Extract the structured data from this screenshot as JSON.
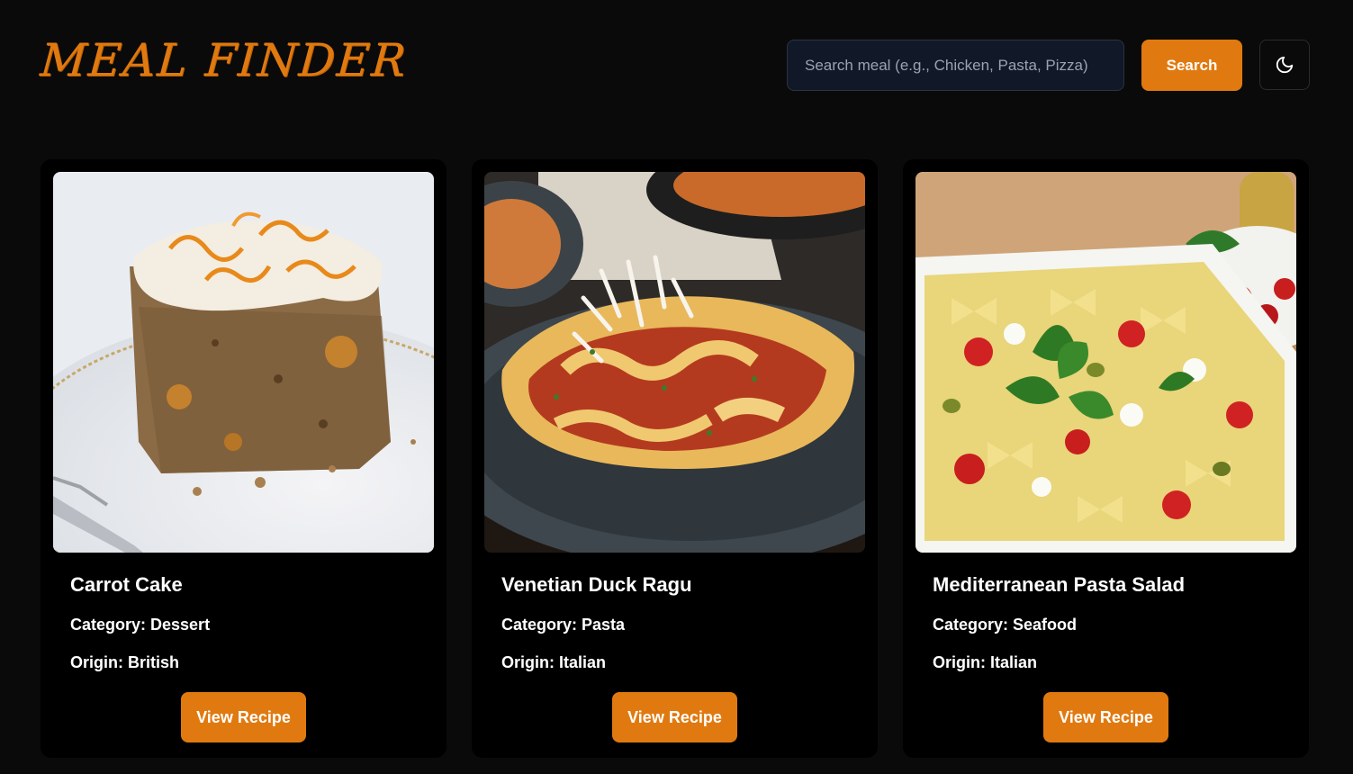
{
  "header": {
    "logo": "MEAL FINDER",
    "search_placeholder": "Search meal (e.g., Chicken, Pasta, Pizza)",
    "search_label": "Search",
    "theme_icon": "moon-icon"
  },
  "colors": {
    "accent": "#e07a10",
    "background": "#0a0a0a",
    "card": "#000000",
    "input": "#111827"
  },
  "meals": [
    {
      "title": "Carrot Cake",
      "category": "Category: Dessert",
      "origin": "Origin: British",
      "button": "View Recipe"
    },
    {
      "title": "Venetian Duck Ragu",
      "category": "Category: Pasta",
      "origin": "Origin: Italian",
      "button": "View Recipe"
    },
    {
      "title": "Mediterranean Pasta Salad",
      "category": "Category: Seafood",
      "origin": "Origin: Italian",
      "button": "View Recipe"
    }
  ]
}
